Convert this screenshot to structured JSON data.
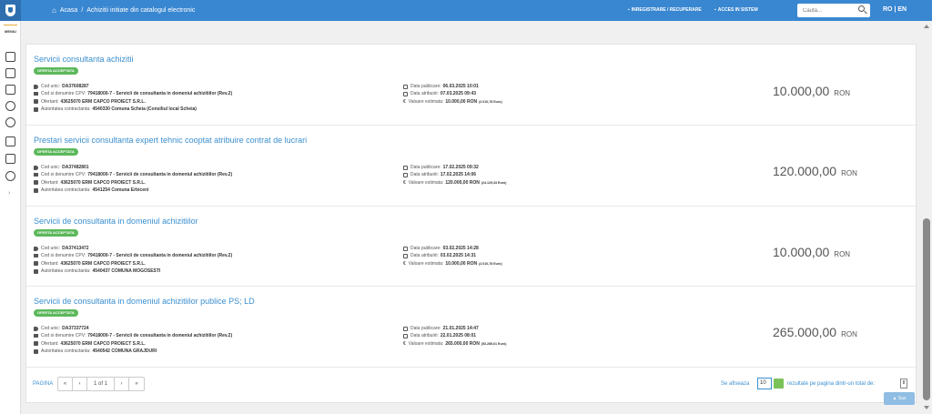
{
  "header": {
    "breadcrumb_home": "Acasa",
    "breadcrumb_sep": "/",
    "breadcrumb_page": "Achizitii initiate din catalogul electronic",
    "register_label": "INREGISTRARE / RECUPERARE",
    "login_label": "ACCES IN SISTEM",
    "search_placeholder": "Cauta...",
    "lang": "RO | EN"
  },
  "sidebar": {
    "menu_label": "MENIU",
    "expand_arrow": "›"
  },
  "items": [
    {
      "title": "Servicii consultanta achizitii",
      "badge": "OFERTA ACCEPTATA",
      "cod_label": "Cod unic:",
      "cod": "DA37608287",
      "cpv_label": "Cod si denumire CPV:",
      "cpv": "79418000-7 - Servicii de consultanta in domeniul achizitiilor (Rev.2)",
      "ofertant_label": "Ofertant:",
      "ofertant": "43625070 ERM CAPCO PROIECT S.R.L.",
      "autoritate_label": "Autoritatea contractanta:",
      "autoritate": "4540330 Comuna Scheia (Consiliul local Scheia)",
      "pub_label": "Data publicare:",
      "pub": "06.03.2025 10:01",
      "atr_label": "Data atribuirii:",
      "atr": "07.03.2025 09:43",
      "val_label": "Valoare estimata:",
      "val": "10.000,00  RON",
      "eur": "(2.010,78  Euro)",
      "price": "10.000,00",
      "currency": "RON"
    },
    {
      "title": "Prestari servicii consultanta expert tehnic cooptat atribuire contrat de lucrari",
      "badge": "OFERTA ACCEPTATA",
      "cod_label": "Cod unic:",
      "cod": "DA37482801",
      "cpv_label": "Cod si denumire CPV:",
      "cpv": "79418000-7 - Servicii de consultanta in domeniul achizitiilor (Rev.2)",
      "ofertant_label": "Ofertant:",
      "ofertant": "43625070 ERM CAPCO PROIECT S.R.L.",
      "autoritate_label": "Autoritatea contractanta:",
      "autoritate": "4541254 Comuna Erbiceni",
      "pub_label": "Data publicare:",
      "pub": "17.02.2025 09:32",
      "atr_label": "Data atribuirii:",
      "atr": "17.02.2025 14:06",
      "val_label": "Valoare estimata:",
      "val": "120.000,00  RON",
      "eur": "(24.129,33  Euro)",
      "price": "120.000,00",
      "currency": "RON"
    },
    {
      "title": "Servicii de consultanta in domeniul achizitiilor",
      "badge": "OFERTA ACCEPTATA",
      "cod_label": "Cod unic:",
      "cod": "DA37413472",
      "cpv_label": "Cod si denumire CPV:",
      "cpv": "79418000-7 - Servicii de consultanta in domeniul achizitiilor (Rev.2)",
      "ofertant_label": "Ofertant:",
      "ofertant": "43625070 ERM CAPCO PROIECT S.R.L.",
      "autoritate_label": "Autoritatea contractanta:",
      "autoritate": "4540437 COMUNA MOGOSESTI",
      "pub_label": "Data publicare:",
      "pub": "03.02.2025 14:28",
      "atr_label": "Data atribuirii:",
      "atr": "03.02.2025 14:31",
      "val_label": "Valoare estimata:",
      "val": "10.000,00  RON",
      "eur": "(2.010,78  Euro)",
      "price": "10.000,00",
      "currency": "RON"
    },
    {
      "title": "Servicii de consultanta in domeniul achizitiilor publice PS; LD",
      "badge": "OFERTA ACCEPTATA",
      "cod_label": "Cod unic:",
      "cod": "DA37337724",
      "cpv_label": "Cod si denumire CPV:",
      "cpv": "79418000-7 - Servicii de consultanta in domeniul achizitiilor (Rev.2)",
      "ofertant_label": "Ofertant:",
      "ofertant": "43625070 ERM CAPCO PROIECT S.R.L.",
      "autoritate_label": "Autoritatea contractanta:",
      "autoritate": "4540542 COMUNA GRAJDURI",
      "pub_label": "Data publicare:",
      "pub": "21.01.2025 14:47",
      "atr_label": "Data atribuirii:",
      "atr": "22.01.2025 08:01",
      "val_label": "Valoare estimata:",
      "val": "265.000,00  RON",
      "eur": "(53.285,61  Euro)",
      "price": "265.000,00",
      "currency": "RON"
    }
  ],
  "pagination": {
    "label": "PAGINA",
    "first": "«",
    "prev": "‹",
    "page_info": "1 of 1",
    "next": "›",
    "last": "»",
    "showing_label": "Se afiseaza",
    "per_page": "10",
    "results_label": "rezultate pe pagina dintr-un total de:",
    "total": "8",
    "top_button": "Sus"
  }
}
